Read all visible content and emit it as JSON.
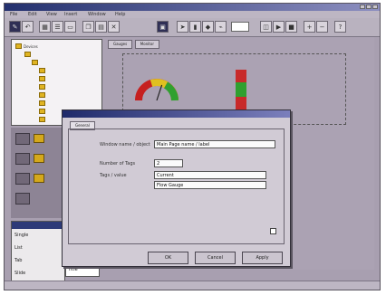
{
  "window": {
    "title": ""
  },
  "menu": {
    "items": [
      "File",
      "Edit",
      "View",
      "Insert",
      "Window",
      "Help"
    ]
  },
  "toolbar": {
    "icons": [
      "save-icon",
      "undo-icon",
      "grid-icon",
      "list-icon",
      "folder-icon",
      "copy-icon",
      "paste-icon",
      "delete-icon",
      "picture-icon",
      "arrow-icon",
      "bar-icon",
      "node-icon",
      "link-icon",
      "chart-icon",
      "play-icon",
      "stop-icon",
      "zoom-in-icon",
      "zoom-out-icon",
      "help-icon"
    ],
    "field_value": ""
  },
  "tree": {
    "root": "Devices"
  },
  "canvas": {
    "tabs": [
      "Gauges",
      "Monitor"
    ],
    "gauges": [
      {
        "value": 0.6
      },
      {
        "value": 0.75
      }
    ]
  },
  "dialog": {
    "title": "",
    "tab": "General",
    "fields": {
      "name_label": "Window name / object",
      "name_value": "Main Page name / label",
      "number_label": "Number of Tags",
      "number_value": "2",
      "tag_label": "Tags / value",
      "tag1": "Current",
      "tag2": "Flow Gauge"
    },
    "checkbox_label": "",
    "buttons": {
      "ok": "OK",
      "cancel": "Cancel",
      "apply": "Apply"
    }
  },
  "list_panel": {
    "header": "",
    "rows": [
      "Single",
      "List",
      "Tab",
      "Slide"
    ],
    "field_value": "Title"
  }
}
